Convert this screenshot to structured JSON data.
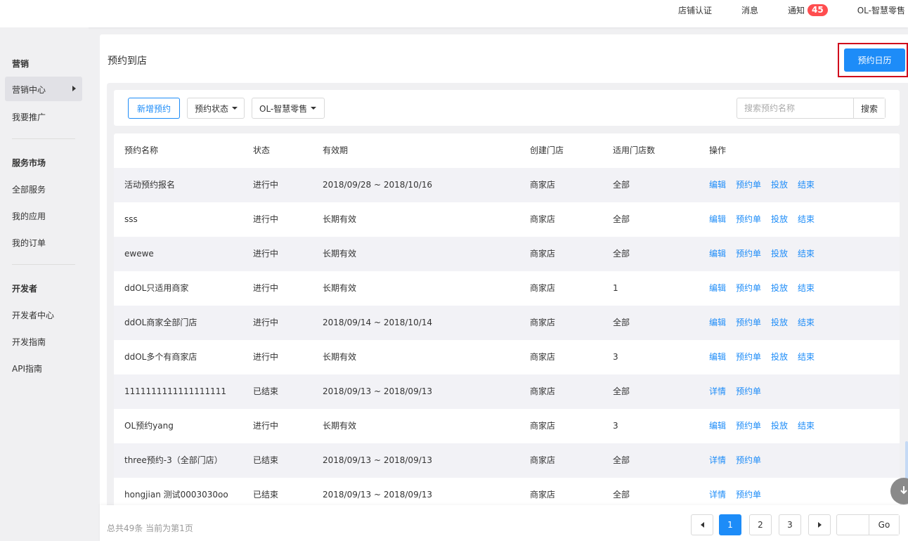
{
  "topbar": {
    "items": [
      "店铺认证",
      "消息",
      "通知",
      "OL-智慧零售"
    ],
    "notify_count": "45"
  },
  "sidebar": {
    "group_marketing": "营销",
    "item_marketing_center": "营销中心",
    "item_promote": "我要推广",
    "group_service": "服务市场",
    "item_all_services": "全部服务",
    "item_my_apps": "我的应用",
    "item_my_orders": "我的订单",
    "group_developer": "开发者",
    "item_dev_center": "开发者中心",
    "item_dev_guide": "开发指南",
    "item_api_guide": "API指南"
  },
  "page": {
    "title": "预约到店",
    "calendar_button": "预约日历"
  },
  "toolbar": {
    "add_button": "新增预约",
    "status_dropdown": "预约状态",
    "store_dropdown": "OL-智慧零售",
    "search_placeholder": "搜索预约名称",
    "search_button": "搜索"
  },
  "table": {
    "headers": {
      "name": "预约名称",
      "status": "状态",
      "period": "有效期",
      "store": "创建门店",
      "count": "适用门店数",
      "ops": "操作"
    },
    "rows": [
      {
        "name": "活动预约报名",
        "status": "进行中",
        "period": "2018/09/28 ~ 2018/10/16",
        "store": "商家店",
        "count": "全部",
        "ops": [
          "编辑",
          "预约单",
          "投放",
          "结束"
        ]
      },
      {
        "name": "sss",
        "status": "进行中",
        "period": "长期有效",
        "store": "商家店",
        "count": "全部",
        "ops": [
          "编辑",
          "预约单",
          "投放",
          "结束"
        ]
      },
      {
        "name": "ewewe",
        "status": "进行中",
        "period": "长期有效",
        "store": "商家店",
        "count": "全部",
        "ops": [
          "编辑",
          "预约单",
          "投放",
          "结束"
        ]
      },
      {
        "name": "ddOL只适用商家",
        "status": "进行中",
        "period": "长期有效",
        "store": "商家店",
        "count": "1",
        "ops": [
          "编辑",
          "预约单",
          "投放",
          "结束"
        ]
      },
      {
        "name": "ddOL商家全部门店",
        "status": "进行中",
        "period": "2018/09/14 ~ 2018/10/14",
        "store": "商家店",
        "count": "全部",
        "ops": [
          "编辑",
          "预约单",
          "投放",
          "结束"
        ]
      },
      {
        "name": "ddOL多个有商家店",
        "status": "进行中",
        "period": "长期有效",
        "store": "商家店",
        "count": "3",
        "ops": [
          "编辑",
          "预约单",
          "投放",
          "结束"
        ]
      },
      {
        "name": "1111111111111111111",
        "status": "已结束",
        "period": "2018/09/13 ~ 2018/09/13",
        "store": "商家店",
        "count": "全部",
        "ops": [
          "详情",
          "预约单"
        ]
      },
      {
        "name": "OL预约yang",
        "status": "进行中",
        "period": "长期有效",
        "store": "商家店",
        "count": "3",
        "ops": [
          "编辑",
          "预约单",
          "投放",
          "结束"
        ]
      },
      {
        "name": "three预约-3（全部门店）",
        "status": "已结束",
        "period": "2018/09/13 ~ 2018/09/13",
        "store": "商家店",
        "count": "全部",
        "ops": [
          "详情",
          "预约单"
        ]
      },
      {
        "name": "hongjian 测试0003030oo",
        "status": "已结束",
        "period": "2018/09/13 ~ 2018/09/13",
        "store": "商家店",
        "count": "全部",
        "ops": [
          "详情",
          "预约单"
        ]
      }
    ]
  },
  "footer": {
    "summary": "总共49条 当前为第1页",
    "pages": [
      "1",
      "2",
      "3"
    ],
    "current_page": "1",
    "go_button": "Go"
  },
  "colors": {
    "primary": "#1d8cf8",
    "badge": "#ff4d4f",
    "highlight_border": "#d0021b"
  }
}
